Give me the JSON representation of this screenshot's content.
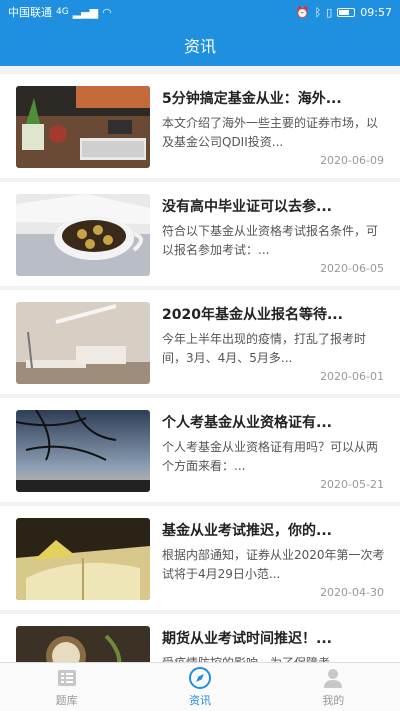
{
  "status": {
    "carrier": "中国联通",
    "network": "4G",
    "time": "09:57"
  },
  "header": {
    "title": "资讯"
  },
  "articles": [
    {
      "title": "5分钟搞定基金从业：海外...",
      "desc": "本文介绍了海外一些主要的证券市场，以及基金公司QDII投资...",
      "date": "2020-06-09"
    },
    {
      "title": "没有高中毕业证可以去参...",
      "desc": "符合以下基金从业资格考试报名条件，可以报名参加考试：...",
      "date": "2020-06-05"
    },
    {
      "title": "2020年基金从业报名等待...",
      "desc": "今年上半年出现的疫情，打乱了报考时间，3月、4月、5月多...",
      "date": "2020-06-01"
    },
    {
      "title": "个人考基金从业资格证有...",
      "desc": "个人考基金从业资格证有用吗？可以从两个方面来看：...",
      "date": "2020-05-21"
    },
    {
      "title": "基金从业考试推迟，你的...",
      "desc": "根据内部通知，证券从业2020年第一次考试将于4月29日小范...",
      "date": "2020-04-30"
    },
    {
      "title": "期货从业考试时间推迟！...",
      "desc": "受疫情防控的影响，为了保障考",
      "date": ""
    }
  ],
  "tabs": [
    {
      "label": "题库",
      "icon": "question-bank-icon"
    },
    {
      "label": "资讯",
      "icon": "compass-icon"
    },
    {
      "label": "我的",
      "icon": "person-icon"
    }
  ],
  "colors": {
    "accent": "#1f8fe0",
    "title_text": "#222222",
    "desc_text": "#555555",
    "date_text": "#999999"
  }
}
